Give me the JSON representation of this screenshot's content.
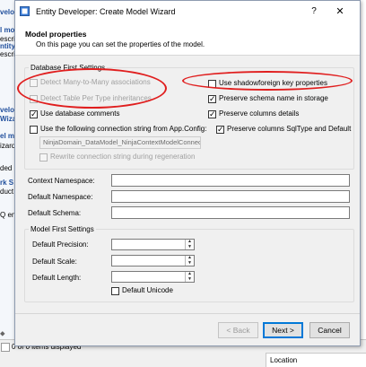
{
  "background": {
    "left_fragments": [
      "velo",
      "l mo",
      "escri",
      "ntity",
      "escri",
      "velo",
      "Wiza",
      "el ma",
      "izard",
      "ded b",
      "rk S",
      "duct",
      "Q eng",
      "⬥"
    ],
    "status_text": "0 of 0 items displayed",
    "location_col": "Location"
  },
  "dialog": {
    "title": "Entity Developer: Create Model Wizard",
    "help": "?",
    "close": "✕",
    "header_title": "Model properties",
    "header_subtitle": "On this page you can set the properties of the model."
  },
  "db_first": {
    "group_label": "Database First Settings",
    "detect_many_to_many": "Detect Many-to-Many associations",
    "detect_tpt": "Detect Table Per Type inheritances",
    "use_db_comments": "Use database comments",
    "use_conn_string": "Use the following connection string from App.Config:",
    "conn_string_value": "NinjaDomain_DataModel_NinjaContextModelConnection",
    "rewrite_conn": "Rewrite connection string during regeneration",
    "use_shadow_fk": "Use shadowforeign key properties",
    "preserve_schema": "Preserve schema name in storage",
    "preserve_columns": "Preserve columns details",
    "preserve_sqltype": "Preserve columns SqlType and Default"
  },
  "fields": {
    "context_ns_label": "Context Namespace:",
    "default_ns_label": "Default Namespace:",
    "default_schema_label": "Default Schema:"
  },
  "model_first": {
    "group_label": "Model First Settings",
    "precision_label": "Default Precision:",
    "scale_label": "Default Scale:",
    "length_label": "Default Length:",
    "unicode_label": "Default Unicode"
  },
  "buttons": {
    "back": "< Back",
    "next": "Next >",
    "cancel": "Cancel"
  },
  "colors": {
    "annotation": "#e01e1e",
    "accent": "#0078d7"
  }
}
